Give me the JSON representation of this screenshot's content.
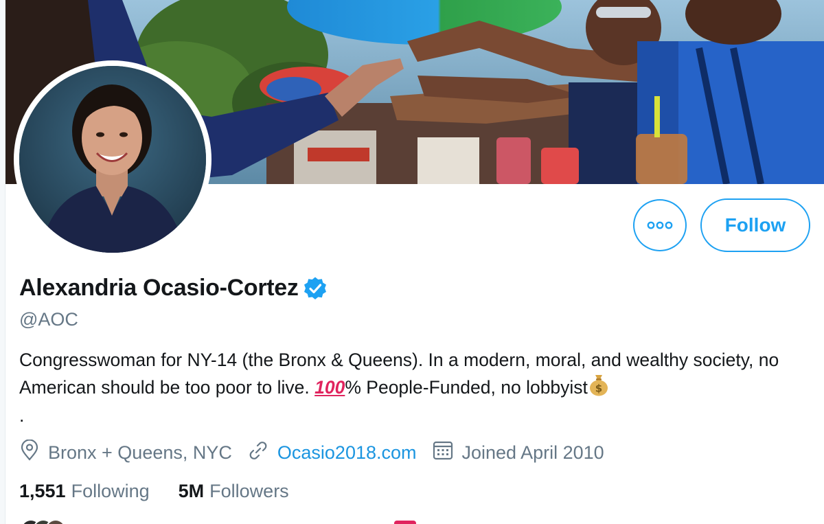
{
  "profile": {
    "display_name": "Alexandria Ocasio-Cortez",
    "handle": "@AOC",
    "bio_part1": "Congresswoman for NY-14 (the Bronx & Queens). In a modern, moral, and wealthy society, no American should be too poor to live. ",
    "bio_emoji": "100",
    "bio_part2": "% People-Funded, no lobbyist",
    "bio_trailing": ".",
    "location": "Bronx + Queens, NYC",
    "website": "Ocasio2018.com",
    "joined": "Joined April 2010"
  },
  "actions": {
    "follow_label": "Follow"
  },
  "stats": {
    "following_count": "1,551",
    "following_label": "Following",
    "followers_count": "5M",
    "followers_label": "Followers"
  },
  "icons": {
    "more": "more-options-icon",
    "verified": "verified-badge-icon",
    "location": "location-pin-icon",
    "link": "link-icon",
    "calendar": "calendar-icon",
    "moneybag": "money-bag-emoji"
  },
  "colors": {
    "accent": "#1da1f2",
    "link": "#1b95e0",
    "text_primary": "#14171a",
    "text_secondary": "#657786"
  }
}
